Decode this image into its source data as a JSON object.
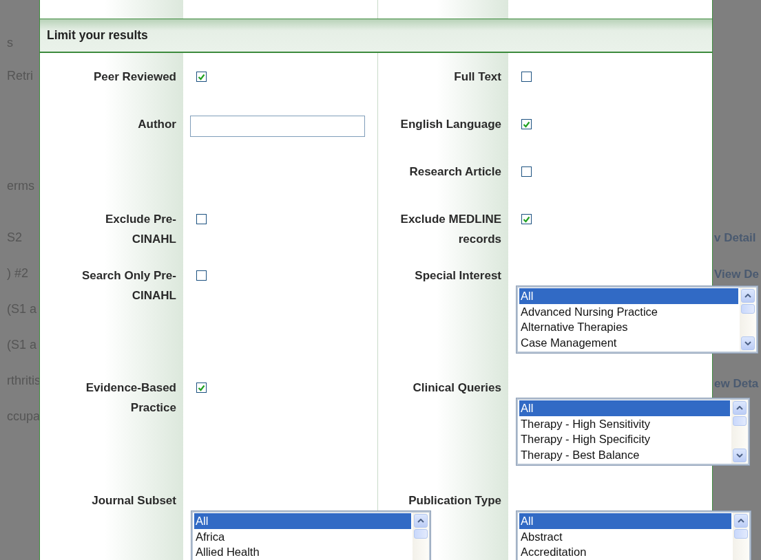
{
  "background": {
    "left": [
      {
        "text": "s"
      },
      {
        "text": "Retri"
      },
      {
        "text": "erms"
      },
      {
        "text": "S2"
      },
      {
        "text": ") #2"
      },
      {
        "text": "(S1 a"
      },
      {
        "text": "(S1 a"
      },
      {
        "text": "rthritis"
      },
      {
        "text": "ccupa"
      }
    ],
    "right": [
      {
        "text": "v Detail"
      },
      {
        "text": "View De"
      },
      {
        "text": "ew Deta"
      }
    ]
  },
  "title": "Limit your results",
  "rows": [
    {
      "left": {
        "kind": "checkbox",
        "label": "Peer Reviewed",
        "checked": true
      },
      "right": {
        "kind": "checkbox",
        "label": "Full Text",
        "checked": false
      }
    },
    {
      "left": {
        "kind": "text",
        "label": "Author"
      },
      "right": {
        "kind": "checkbox",
        "label": "English Language",
        "checked": true
      }
    },
    {
      "right": {
        "kind": "checkbox",
        "label": "Research Article",
        "checked": false
      }
    },
    {
      "left": {
        "kind": "checkbox",
        "label": "Exclude Pre-CINAHL",
        "checked": false
      },
      "right": {
        "kind": "checkbox",
        "label": "Exclude MEDLINE records",
        "checked": true
      }
    },
    {
      "left": {
        "kind": "checkbox",
        "label": "Search Only Pre-CINAHL",
        "checked": false
      },
      "right": {
        "kind": "listbox",
        "label": "Special Interest",
        "options": [
          {
            "label": "All",
            "selected": true
          },
          {
            "label": "Advanced Nursing Practice",
            "selected": false
          },
          {
            "label": "Alternative Therapies",
            "selected": false
          },
          {
            "label": "Case Management",
            "selected": false
          }
        ]
      }
    },
    {
      "left": {
        "kind": "checkbox",
        "label": "Evidence-Based Practice",
        "checked": true
      },
      "right": {
        "kind": "listbox",
        "label": "Clinical Queries",
        "options": [
          {
            "label": "All",
            "selected": true
          },
          {
            "label": "Therapy - High Sensitivity",
            "selected": false
          },
          {
            "label": "Therapy - High Specificity",
            "selected": false
          },
          {
            "label": "Therapy - Best Balance",
            "selected": false
          }
        ]
      }
    },
    {
      "left": {
        "kind": "listbox",
        "label": "Journal Subset",
        "options": [
          {
            "label": "All",
            "selected": true
          },
          {
            "label": "Africa",
            "selected": false
          },
          {
            "label": "Allied Health",
            "selected": false
          }
        ]
      },
      "right": {
        "kind": "listbox",
        "label": "Publication Type",
        "options": [
          {
            "label": "All",
            "selected": true
          },
          {
            "label": "Abstract",
            "selected": false
          },
          {
            "label": "Accreditation",
            "selected": false
          }
        ]
      }
    }
  ]
}
